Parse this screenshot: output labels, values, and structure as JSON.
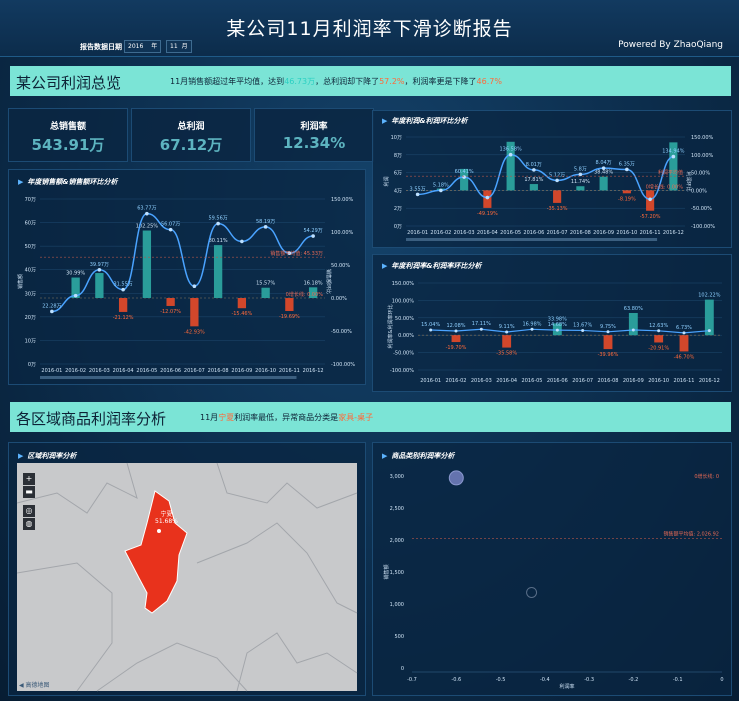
{
  "header": {
    "title": "某公司11月利润率下滑诊断报告",
    "date_label": "报告数据日期",
    "year": "2016",
    "year_unit": "年",
    "month": "11",
    "month_unit": "月",
    "powered_by": "Powered By ZhaoQiang"
  },
  "banner1": {
    "heading": "某公司利润总览",
    "text_a": "11月销售额超过年平均值，达到",
    "value_a": "46.73万",
    "text_b": "，总利润却下降了",
    "value_b": "57.2%",
    "text_c": "，利润率更是下降了",
    "value_c": "46.7%"
  },
  "kpis": [
    {
      "label": "总销售额",
      "value": "543.91万"
    },
    {
      "label": "总利润",
      "value": "67.12万"
    },
    {
      "label": "利润率",
      "value": "12.34%"
    }
  ],
  "banner2": {
    "heading": "各区域商品利润率分析",
    "text_a": "11月",
    "value_a": "宁夏",
    "text_b": "利润率最低，异常商品分类是",
    "value_b": "家具-桌子"
  },
  "colors": {
    "accent": "#7be4d6",
    "bar": "#2a9d9a",
    "neg": "#d2472b",
    "line": "#4aa3ff",
    "map_region": "#e8321c"
  },
  "chart_data": [
    {
      "type": "bar",
      "title": "年度销售额&销售额环比分析",
      "categories": [
        "2016-01",
        "2016-02",
        "2016-03",
        "2016-04",
        "2016-05",
        "2016-06",
        "2016-07",
        "2016-08",
        "2016-09",
        "2016-10",
        "2016-11",
        "2016-12"
      ],
      "y_ticks": [
        "0万",
        "10万",
        "20万",
        "30万",
        "40万",
        "50万",
        "60万",
        "70万"
      ],
      "y2_ticks": [
        "-100.00%",
        "-50.00%",
        "0.00%",
        "50.00%",
        "100.00%",
        "150.00%"
      ],
      "ylabel": "销售额",
      "y2label": "销售额环比",
      "series": [
        {
          "name": "销售额",
          "values": [
            22.28,
            29.0,
            39.97,
            31.55,
            63.77,
            57.0,
            33.0,
            59.56,
            52.0,
            58.19,
            47.0,
            54.29
          ],
          "labels": [
            "22.28万",
            "",
            "39.97万",
            "31.55万",
            "63.77万",
            "56.07万",
            "",
            "59.56万",
            "",
            "58.19万",
            "",
            "54.29万"
          ]
        },
        {
          "name": "销售额环比",
          "values": [
            0,
            30.99,
            37.83,
            -21.12,
            102.25,
            -12.07,
            -42.93,
            80.11,
            -15.46,
            15.57,
            -19.69,
            16.18
          ],
          "labels": [
            "",
            "30.99%",
            "",
            "-21.12%",
            "102.25%",
            "-12.07%",
            "-42.93%",
            "80.11%",
            "-15.46%",
            "15.57%",
            "-19.69%",
            "16.18%"
          ]
        }
      ],
      "annotations": [
        "销售额平均值: 45.33万",
        "0增长线: 0.00%"
      ]
    },
    {
      "type": "bar",
      "title": "年度利润&利润环比分析",
      "categories": [
        "2016-01",
        "2016-02",
        "2016-03",
        "2016-04",
        "2016-05",
        "2016-06",
        "2016-07",
        "2016-08",
        "2016-09",
        "2016-10",
        "2016-11",
        "2016-12"
      ],
      "y_ticks": [
        "0万",
        "2万",
        "4万",
        "6万",
        "8万",
        "10万"
      ],
      "y2_ticks": [
        "-100.00%",
        "-50.00%",
        "0.00%",
        "50.00%",
        "100.00%",
        "150.00%"
      ],
      "ylabel": "利润",
      "y2label": "利润环比",
      "series": [
        {
          "name": "利润",
          "values": [
            3.55,
            4.0,
            5.5,
            3.2,
            8.01,
            6.3,
            5.12,
            5.8,
            6.5,
            6.35,
            3.0,
            7.8
          ],
          "labels": [
            "3.55万",
            "5.18%",
            "60.41%",
            "",
            "136.58%",
            "8.01万",
            "5.12万",
            "5.8万",
            "8.04万",
            "6.35万",
            "",
            "134.94%"
          ]
        },
        {
          "name": "利润环比",
          "values": [
            0,
            5.18,
            60.41,
            -49.19,
            136.58,
            17.81,
            -35.13,
            11.74,
            38.48,
            -8.19,
            -57.2,
            134.94
          ],
          "labels": [
            "",
            "",
            "",
            "-49.19%",
            "",
            "17.81%",
            "-35.13%",
            "11.74%",
            "38.48%",
            "-8.19%",
            "-57.20%",
            ""
          ]
        }
      ],
      "annotations": [
        "利润平均值",
        "0增长线: 0.00%"
      ]
    },
    {
      "type": "bar",
      "title": "年度利润率&利润率环比分析",
      "categories": [
        "2016-01",
        "2016-02",
        "2016-03",
        "2016-04",
        "2016-05",
        "2016-06",
        "2016-07",
        "2016-08",
        "2016-09",
        "2016-10",
        "2016-11",
        "2016-12"
      ],
      "y_ticks": [
        "-100.00%",
        "-50.00%",
        "0.00%",
        "50.00%",
        "100.00%",
        "150.00%"
      ],
      "ylabel": "利润率&利润率环比",
      "series": [
        {
          "name": "利润率",
          "values": [
            15.04,
            12.08,
            17.11,
            9.11,
            16.98,
            14.68,
            13.67,
            9.75,
            15.0,
            12.63,
            6.73,
            13.0
          ],
          "labels": [
            "15.04%",
            "12.08%",
            "17.11%",
            "9.11%",
            "16.98%",
            "14.68%",
            "13.67%",
            "9.75%",
            "",
            "12.63%",
            "6.73%",
            ""
          ]
        },
        {
          "name": "利润率环比",
          "values": [
            0,
            -19.7,
            0,
            -35.58,
            0,
            33.98,
            0,
            -39.96,
            63.8,
            -20.91,
            -46.7,
            102.22
          ],
          "labels": [
            "",
            "-19.70%",
            "",
            "-35.58%",
            "",
            "33.98%",
            "",
            "-39.96%",
            "63.80%",
            "-20.91%",
            "-46.70%",
            "102.22%"
          ]
        }
      ]
    },
    {
      "type": "scatter",
      "title": "商品类别利润率分析",
      "xlabel": "利润率",
      "ylabel": "销售额",
      "x_ticks": [
        "-0.7",
        "-0.6",
        "-0.5",
        "-0.4",
        "-0.3",
        "-0.2",
        "-0.1",
        "0"
      ],
      "y_ticks": [
        "0",
        "500",
        "1,000",
        "1,500",
        "2,000",
        "2,500",
        "3,000"
      ],
      "points": [
        {
          "x": -0.6,
          "y": 2970
        },
        {
          "x": -0.43,
          "y": 1180
        }
      ],
      "annotations": [
        "0增长线: 0",
        "销售额平均值: 2,026.92"
      ]
    },
    {
      "type": "map",
      "title": "区域利润率分析",
      "region": "宁夏",
      "region_value": "51.68%",
      "source": "高德地图"
    }
  ]
}
